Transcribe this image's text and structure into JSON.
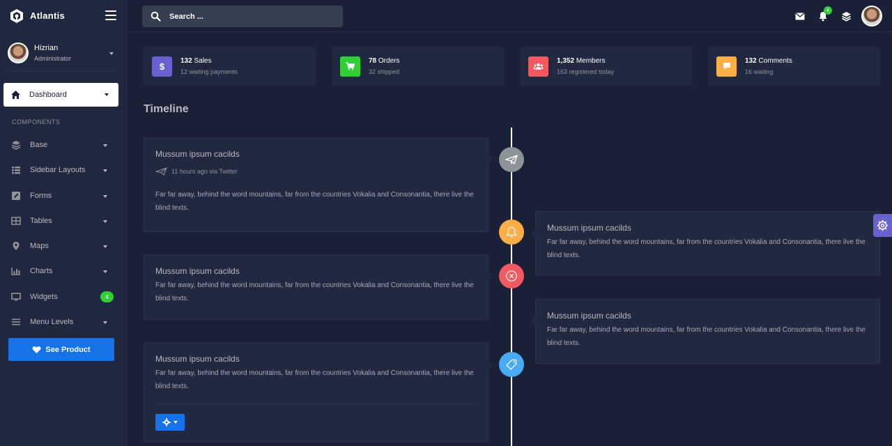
{
  "brand": {
    "name": "Atlantis"
  },
  "user": {
    "name": "Hizrian",
    "role": "Administrator"
  },
  "nav": {
    "active": {
      "label": "Dashboard",
      "icon": "home-icon"
    },
    "section": "COMPONENTS",
    "items": [
      {
        "label": "Base",
        "icon": "layers-icon"
      },
      {
        "label": "Sidebar Layouts",
        "icon": "th-list-icon"
      },
      {
        "label": "Forms",
        "icon": "pen-square-icon"
      },
      {
        "label": "Tables",
        "icon": "table-icon"
      },
      {
        "label": "Maps",
        "icon": "map-marker-icon"
      },
      {
        "label": "Charts",
        "icon": "bar-chart-icon"
      },
      {
        "label": "Widgets",
        "icon": "desktop-icon",
        "badge": "4"
      },
      {
        "label": "Menu Levels",
        "icon": "bars-icon"
      }
    ],
    "cta": {
      "label": "See Product",
      "icon": "heart-icon"
    }
  },
  "search": {
    "placeholder": "Search ..."
  },
  "topbar": {
    "notifications_count": "4"
  },
  "stats": [
    {
      "value": "132",
      "label": "Sales",
      "sub": "12 waiting payments",
      "color": "#6861ce",
      "icon": "dollar-icon"
    },
    {
      "value": "78",
      "label": "Orders",
      "sub": "32 shipped",
      "color": "#31ce36",
      "icon": "cart-icon"
    },
    {
      "value": "1,352",
      "label": "Members",
      "sub": "163 registered today",
      "color": "#f25961",
      "icon": "users-icon"
    },
    {
      "value": "132",
      "label": "Comments",
      "sub": "16 waiting",
      "color": "#ffad46",
      "icon": "comment-icon"
    }
  ],
  "page": {
    "title": "Timeline"
  },
  "timeline": [
    {
      "title": "Mussum ipsum cacilds",
      "meta": "11 hours ago via Twitter",
      "text": "Far far away, behind the word mountains, far from the countries Vokalia and Consonantia, there live the blind texts.",
      "badge_color": "#8d9498",
      "icon": "paper-plane-icon"
    },
    {
      "title": "Mussum ipsum cacilds",
      "text": "Far far away, behind the word mountains, far from the countries Vokalia and Consonantia, there live the blind texts.",
      "badge_color": "#ffad46",
      "icon": "bell-icon"
    },
    {
      "title": "Mussum ipsum cacilds",
      "text": "Far far away, behind the word mountains, far from the countries Vokalia and Consonantia, there live the blind texts.",
      "badge_color": "#f25961",
      "icon": "close-circle-icon"
    },
    {
      "title": "Mussum ipsum cacilds",
      "text": "Far far away, behind the word mountains, far from the countries Vokalia and Consonantia, there live the blind texts.",
      "badge_color": null,
      "icon": null
    },
    {
      "title": "Mussum ipsum cacilds",
      "text": "Far far away, behind the word mountains, far from the countries Vokalia and Consonantia, there live the blind texts.",
      "badge_color": "#48abf7",
      "icon": "tag-icon"
    }
  ]
}
